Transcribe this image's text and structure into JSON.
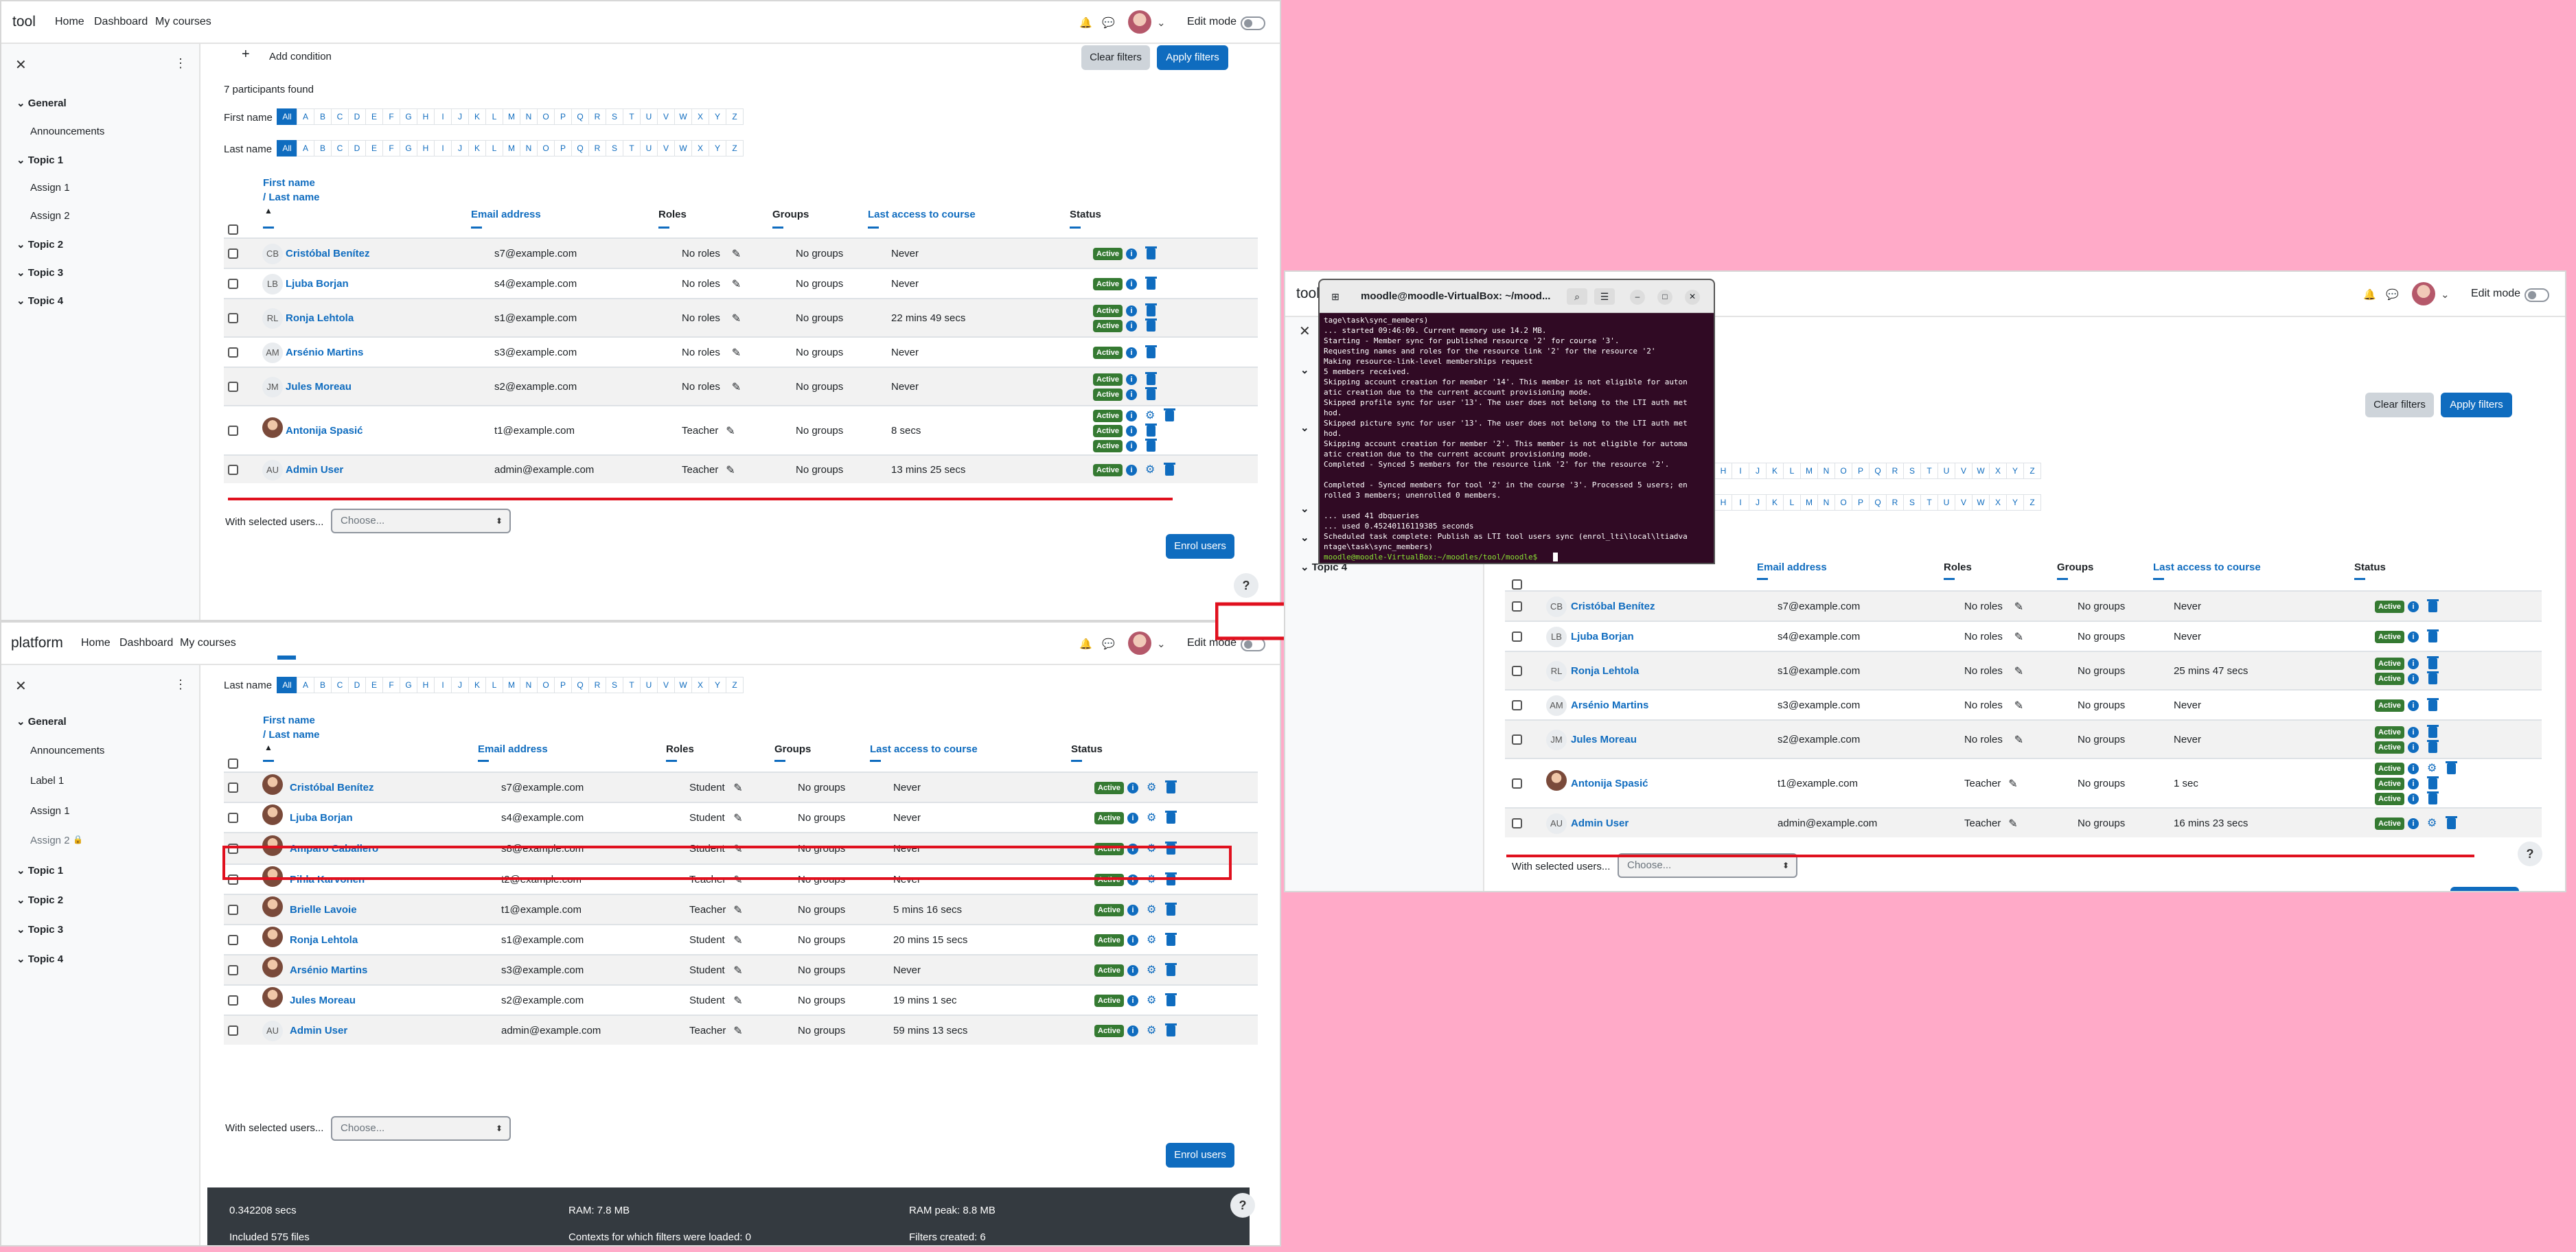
{
  "top_panel": {
    "brand": "tool",
    "nav": {
      "home": "Home",
      "dashboard": "Dashboard",
      "courses": "My courses",
      "edit_mode": "Edit mode"
    },
    "drawer": {
      "general": "General",
      "announcements": "Announcements",
      "topic1": "Topic 1",
      "assign1": "Assign 1",
      "assign2": "Assign 2",
      "topic2": "Topic 2",
      "topic3": "Topic 3",
      "topic4": "Topic 4"
    },
    "add_condition": "Add condition",
    "clear_filters": "Clear filters",
    "apply_filters": "Apply filters",
    "participants_found": "7 participants found",
    "first_name_label": "First name",
    "last_name_label": "Last name",
    "all": "All",
    "headers": {
      "first_name": "First name",
      "last_name": "/ Last name",
      "email": "Email address",
      "roles": "Roles",
      "groups": "Groups",
      "last_access": "Last access to course",
      "status": "Status"
    },
    "rows": [
      {
        "initials": "CB",
        "name": "Cristóbal Benítez",
        "email": "s7@example.com",
        "role": "No roles",
        "groups": "No groups",
        "access": "Never"
      },
      {
        "initials": "LB",
        "name": "Ljuba Borjan",
        "email": "s4@example.com",
        "role": "No roles",
        "groups": "No groups",
        "access": "Never"
      },
      {
        "initials": "RL",
        "name": "Ronja Lehtola",
        "email": "s1@example.com",
        "role": "No roles",
        "groups": "No groups",
        "access": "22 mins 49 secs"
      },
      {
        "initials": "AM",
        "name": "Arsénio Martins",
        "email": "s3@example.com",
        "role": "No roles",
        "groups": "No groups",
        "access": "Never"
      },
      {
        "initials": "JM",
        "name": "Jules Moreau",
        "email": "s2@example.com",
        "role": "No roles",
        "groups": "No groups",
        "access": "Never"
      },
      {
        "initials": "",
        "name": "Antonija Spasić",
        "email": "t1@example.com",
        "role": "Teacher",
        "groups": "No groups",
        "access": "8 secs"
      },
      {
        "initials": "AU",
        "name": "Admin User",
        "email": "admin@example.com",
        "role": "Teacher",
        "groups": "No groups",
        "access": "13 mins 25 secs"
      }
    ],
    "with_selected": "With selected users...",
    "choose": "Choose...",
    "enrol_users": "Enrol users"
  },
  "bottom_panel": {
    "brand": "platform",
    "nav": {
      "home": "Home",
      "dashboard": "Dashboard",
      "courses": "My courses",
      "edit_mode": "Edit mode"
    },
    "drawer": {
      "general": "General",
      "announcements": "Announcements",
      "label1": "Label 1",
      "assign1": "Assign 1",
      "assign2": "Assign 2",
      "topic1": "Topic 1",
      "topic2": "Topic 2",
      "topic3": "Topic 3",
      "topic4": "Topic 4"
    },
    "last_name_label": "Last name",
    "all": "All",
    "headers": {
      "first_name": "First name",
      "last_name": "/ Last name",
      "email": "Email address",
      "roles": "Roles",
      "groups": "Groups",
      "last_access": "Last access to course",
      "status": "Status"
    },
    "rows": [
      {
        "name": "Cristóbal Benítez",
        "email": "s7@example.com",
        "role": "Student",
        "groups": "No groups",
        "access": "Never"
      },
      {
        "name": "Ljuba Borjan",
        "email": "s4@example.com",
        "role": "Student",
        "groups": "No groups",
        "access": "Never"
      },
      {
        "name": "Amparo Caballero",
        "email": "s8@example.com",
        "role": "Student",
        "groups": "No groups",
        "access": "Never"
      },
      {
        "name": "Pihla Karvonen",
        "email": "t2@example.com",
        "role": "Teacher",
        "groups": "No groups",
        "access": "Never"
      },
      {
        "name": "Brielle Lavoie",
        "email": "t1@example.com",
        "role": "Teacher",
        "groups": "No groups",
        "access": "5 mins 16 secs"
      },
      {
        "name": "Ronja Lehtola",
        "email": "s1@example.com",
        "role": "Student",
        "groups": "No groups",
        "access": "20 mins 15 secs"
      },
      {
        "name": "Arsénio Martins",
        "email": "s3@example.com",
        "role": "Student",
        "groups": "No groups",
        "access": "Never"
      },
      {
        "name": "Jules Moreau",
        "email": "s2@example.com",
        "role": "Student",
        "groups": "No groups",
        "access": "19 mins 1 sec"
      },
      {
        "initials": "AU",
        "name": "Admin User",
        "email": "admin@example.com",
        "role": "Teacher",
        "groups": "No groups",
        "access": "59 mins 13 secs"
      }
    ],
    "with_selected": "With selected users...",
    "choose": "Choose...",
    "enrol_users": "Enrol users",
    "footer": {
      "time": "0.342208 secs",
      "ram": "RAM: 7.8 MB",
      "ram_peak": "RAM peak: 8.8 MB",
      "files": "Included 575 files",
      "contexts": "Contexts for which filters were loaded: 0",
      "filters": "Filters created: 6"
    }
  },
  "right_panel": {
    "brand": "tool",
    "edit_mode": "Edit mode",
    "topic4": "Topic 4",
    "clear_filters": "Clear filters",
    "apply_filters": "Apply filters",
    "headers": {
      "email": "Email address",
      "roles": "Roles",
      "groups": "Groups",
      "last_access": "Last access to course",
      "status": "Status"
    },
    "rows": [
      {
        "initials": "CB",
        "name": "Cristóbal Benítez",
        "email": "s7@example.com",
        "role": "No roles",
        "groups": "No groups",
        "access": "Never"
      },
      {
        "initials": "LB",
        "name": "Ljuba Borjan",
        "email": "s4@example.com",
        "role": "No roles",
        "groups": "No groups",
        "access": "Never"
      },
      {
        "initials": "RL",
        "name": "Ronja Lehtola",
        "email": "s1@example.com",
        "role": "No roles",
        "groups": "No groups",
        "access": "25 mins 47 secs"
      },
      {
        "initials": "AM",
        "name": "Arsénio Martins",
        "email": "s3@example.com",
        "role": "No roles",
        "groups": "No groups",
        "access": "Never"
      },
      {
        "initials": "JM",
        "name": "Jules Moreau",
        "email": "s2@example.com",
        "role": "No roles",
        "groups": "No groups",
        "access": "Never"
      },
      {
        "initials": "",
        "name": "Antonija Spasić",
        "email": "t1@example.com",
        "role": "Teacher",
        "groups": "No groups",
        "access": "1 sec"
      },
      {
        "initials": "AU",
        "name": "Admin User",
        "email": "admin@example.com",
        "role": "Teacher",
        "groups": "No groups",
        "access": "16 mins 23 secs"
      }
    ],
    "with_selected": "With selected users...",
    "choose": "Choose..."
  },
  "terminal": {
    "title": "moodle@moodle-VirtualBox: ~/mood...",
    "lines": [
      "tage\\task\\sync_members)",
      "... started 09:46:09. Current memory use 14.2 MB.",
      "Starting - Member sync for published resource '2' for course '3'.",
      "Requesting names and roles for the resource link '2' for the resource '2'",
      "Making resource-link-level memberships request",
      "5 members received.",
      "Skipping account creation for member '14'. This member is not eligible for auton",
      "atic creation due to the current account provisioning mode.",
      "Skipped profile sync for user '13'. The user does not belong to the LTI auth met",
      "hod.",
      "Skipped picture sync for user '13'. The user does not belong to the LTI auth met",
      "hod.",
      "Skipping account creation for member '2'. This member is not eligible for automa",
      "atic creation due to the current account provisioning mode.",
      "Completed - Synced 5 members for the resource link '2' for the resource '2'.",
      "",
      "Completed - Synced members for tool '2' in the course '3'. Processed 5 users; en",
      "rolled 3 members; unenrolled 0 members.",
      "",
      "... used 41 dbqueries",
      "... used 0.45240116119385 seconds",
      "Scheduled task complete: Publish as LTI tool users sync (enrol_lti\\local\\ltiadva",
      "ntage\\task\\sync_members)",
      "moodle@moodle-VirtualBox:~/moodles/tool/moodle$ "
    ]
  },
  "letters": [
    "A",
    "B",
    "C",
    "D",
    "E",
    "F",
    "G",
    "H",
    "I",
    "J",
    "K",
    "L",
    "M",
    "N",
    "O",
    "P",
    "Q",
    "R",
    "S",
    "T",
    "U",
    "V",
    "W",
    "X",
    "Y",
    "Z"
  ],
  "colors": {
    "accent": "#0f6cbf",
    "active": "#357a32",
    "annotation": "#e0101e",
    "background": "#ffaac8"
  }
}
